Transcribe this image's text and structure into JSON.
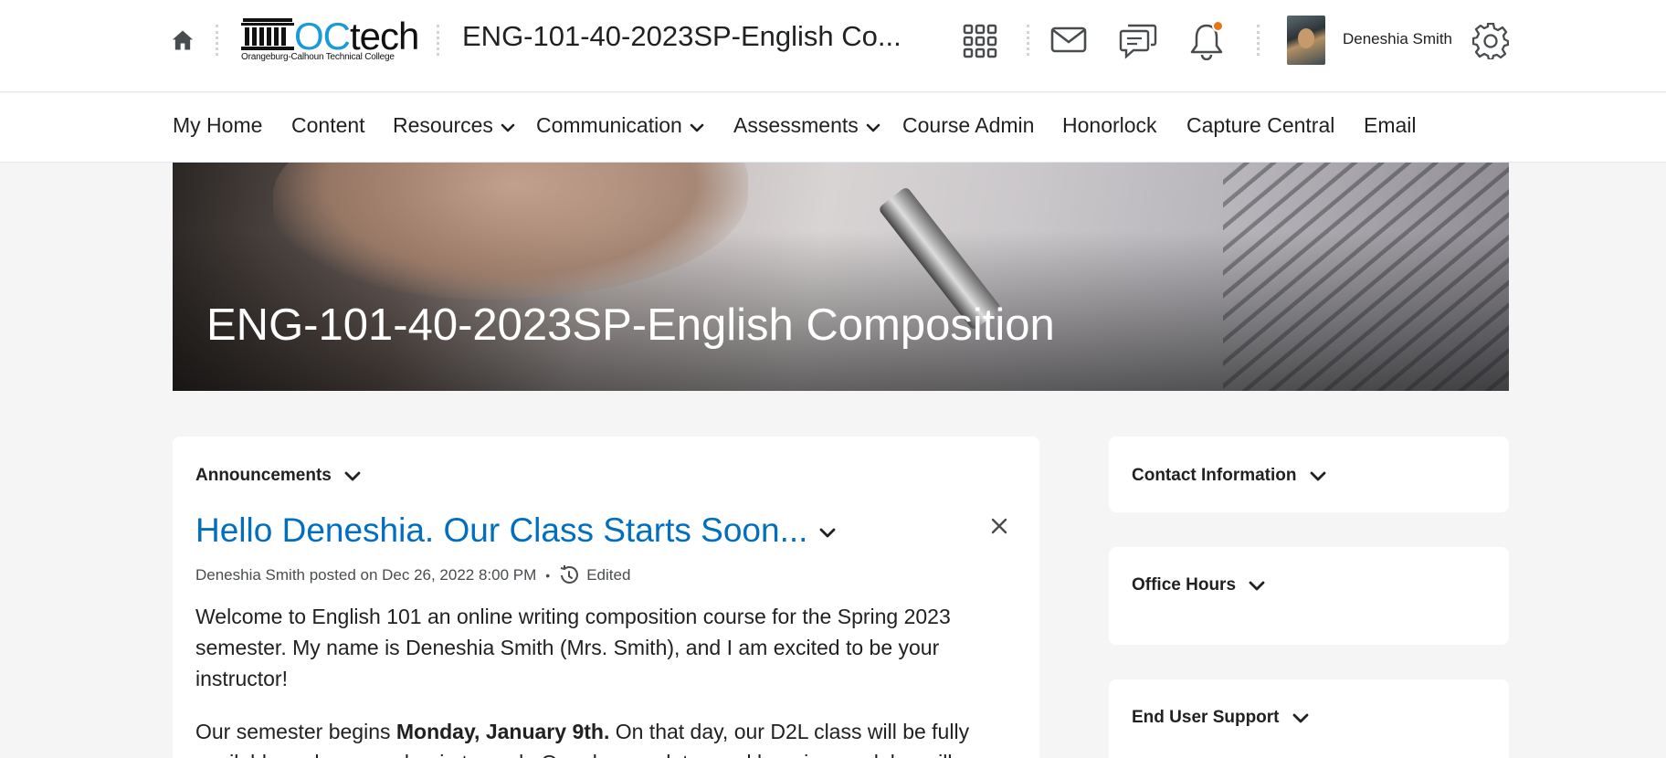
{
  "header": {
    "logo": {
      "word_start": "O",
      "word_accent": "C",
      "word_end": "tech",
      "subtitle": "Orangeburg-Calhoun Technical College"
    },
    "course_title": "ENG-101-40-2023SP-English Co...",
    "user_name": "Deneshia Smith",
    "notification_color": "#e87511",
    "icons": [
      "home-icon",
      "waffle-grid-icon",
      "mail-icon",
      "chat-icon",
      "bell-icon",
      "gear-icon"
    ]
  },
  "nav": {
    "items": [
      {
        "label": "My Home"
      },
      {
        "label": "Content"
      },
      {
        "label": "Resources"
      },
      {
        "label": "Communication"
      },
      {
        "label": "Assessments"
      },
      {
        "label": "Course Admin"
      },
      {
        "label": "Honorlock"
      },
      {
        "label": "Capture Central"
      },
      {
        "label": "Email"
      }
    ]
  },
  "banner": {
    "title": "ENG-101-40-2023SP-English Composition"
  },
  "announcements": {
    "heading": "Announcements",
    "item": {
      "title": "Hello Deneshia. Our Class Starts Soon...",
      "meta": "Deneshia Smith posted on Dec 26, 2022 8:00 PM",
      "separator": "•",
      "edited": "Edited",
      "paragraph1": "Welcome to English 101 an online writing composition course for the Spring 2023 semester. My name is Deneshia Smith (Mrs. Smith), and I am excited to be your instructor!",
      "paragraph2_start": "Our semester begins ",
      "paragraph2_bold": "Monday, January 9th.",
      "paragraph2_end": " On that day, our D2L class will be fully available and you can begin to work. Our class updates and learning modules will"
    }
  },
  "sidebar": {
    "widgets": [
      {
        "heading": "Contact Information"
      },
      {
        "heading": "Office Hours"
      },
      {
        "heading": "End User Support"
      }
    ]
  },
  "colors": {
    "link": "#006fbf",
    "page_bg": "#f5f5f5"
  }
}
